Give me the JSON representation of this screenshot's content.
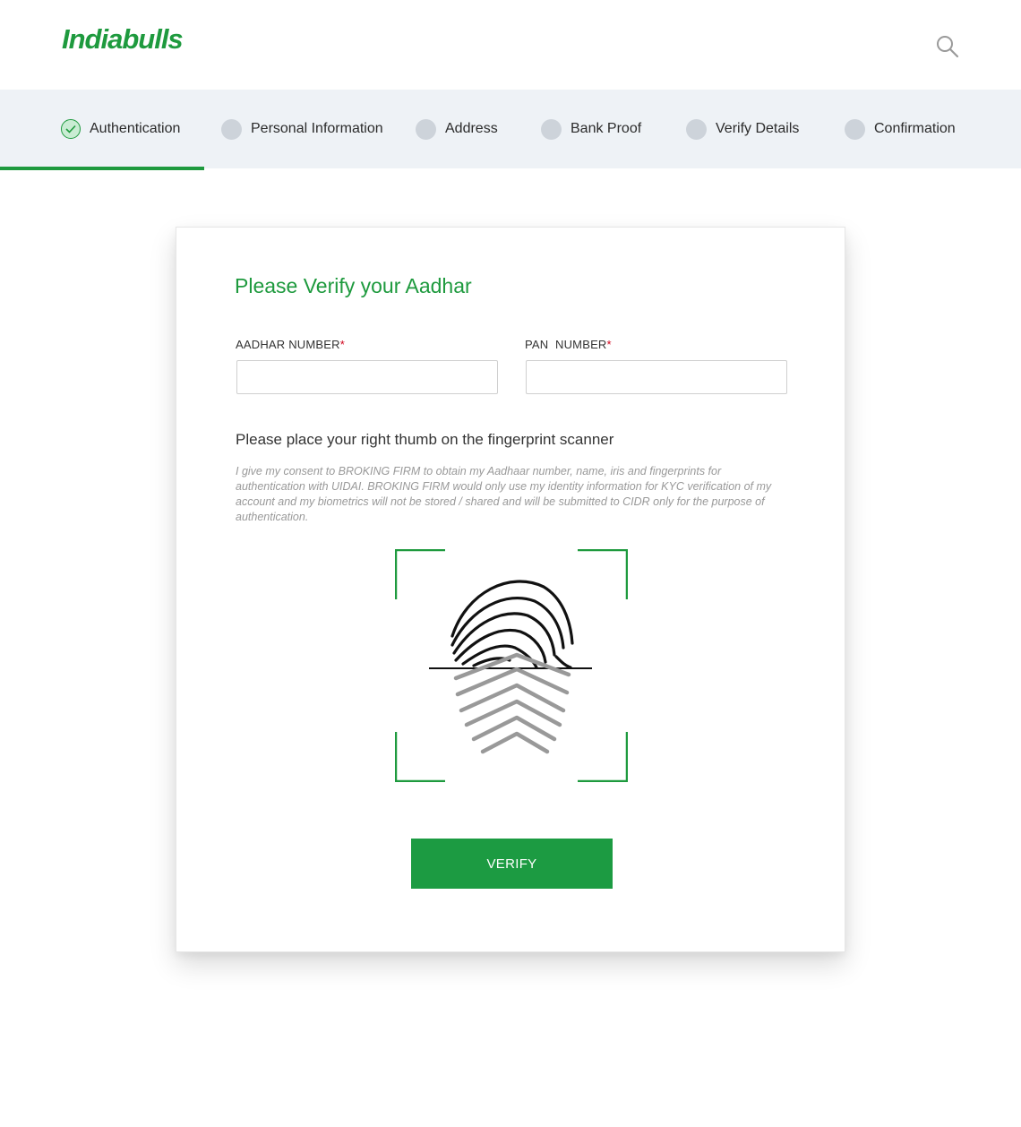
{
  "brand": {
    "name": "Indiabulls",
    "color": "#1e9a3e"
  },
  "header": {
    "search_icon": "search-icon"
  },
  "steps": [
    {
      "label": "Authentication",
      "status": "completed"
    },
    {
      "label": "Personal Information",
      "status": "pending"
    },
    {
      "label": "Address",
      "status": "pending"
    },
    {
      "label": "Bank Proof",
      "status": "pending"
    },
    {
      "label": "Verify Details",
      "status": "pending"
    },
    {
      "label": "Confirmation",
      "status": "pending"
    }
  ],
  "form": {
    "title": "Please Verify your Aadhar",
    "aadhar_label": "AADHAR NUMBER",
    "pan_label": "PAN  NUMBER",
    "required_mark": "*",
    "aadhar_value": "",
    "pan_value": "",
    "instruction": "Please place your right thumb on the fingerprint scanner",
    "consent": "I give my consent to BROKING FIRM to obtain my Aadhaar number, name, iris and fingerprints for authentication with UIDAI. BROKING FIRM would only use my identity information for KYC verification of my account and my biometrics will not be stored / shared and will be submitted to CIDR only for the purpose of authentication.",
    "scanner_icon": "fingerprint-icon",
    "verify_label": "VERIFY"
  },
  "colors": {
    "accent": "#1e9a3e",
    "required": "#d0021b",
    "stepbar_bg": "#eef2f6"
  }
}
